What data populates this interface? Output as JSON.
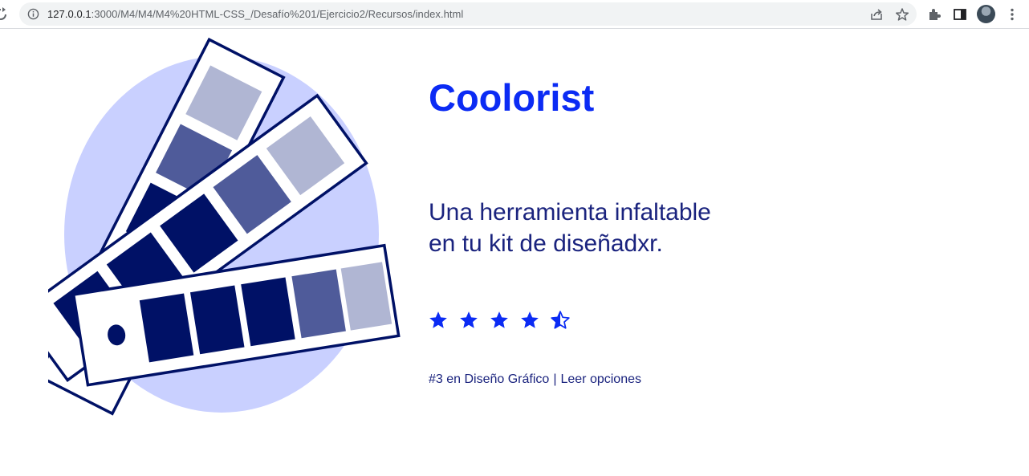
{
  "browser": {
    "url_host": "127.0.0.1",
    "url_path": ":3000/M4/M4/M4%20HTML-CSS_/Desafío%201/Ejercicio2/Recursos/index.html",
    "icons": [
      "reload-icon",
      "site-info-icon",
      "share-icon",
      "bookmark-star-icon",
      "extensions-icon",
      "side-panel-icon",
      "profile-avatar",
      "more-menu-icon"
    ]
  },
  "hero": {
    "title": "Coolorist",
    "subtitle_line1": "Una herramienta infaltable",
    "subtitle_line2": "en tu kit de diseñadxr.",
    "rating": {
      "value": 4.5,
      "max": 5
    },
    "rank_text": "#3 en Diseño Gráfico",
    "separator": "|",
    "link_text": "Leer opciones"
  },
  "colors": {
    "title_blue": "#0b2bf4",
    "text_navy": "#1a237e",
    "swatch_dark": "#001166",
    "swatch_mid": "#4f5b9a",
    "swatch_light": "#b0b6d3",
    "blob_lavender": "#c9d0ff",
    "star_blue": "#0b2bf4"
  }
}
